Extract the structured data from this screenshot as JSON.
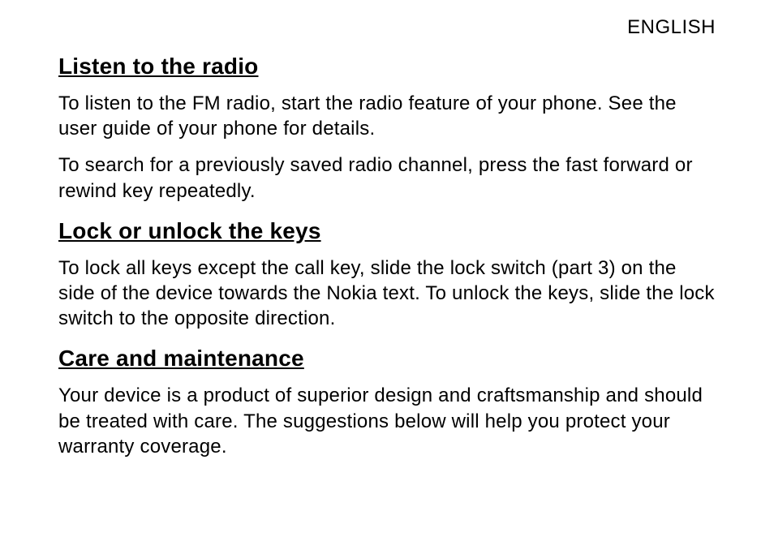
{
  "header": {
    "language": "ENGLISH"
  },
  "sections": [
    {
      "heading": "Listen to the radio",
      "paragraphs": [
        "To listen to the FM radio, start the radio feature of your phone. See the user guide of your phone for details.",
        "To search for a previously saved radio channel, press the fast forward or rewind key repeatedly."
      ]
    },
    {
      "heading": "Lock or unlock the keys",
      "paragraphs": [
        "To lock all keys except the call key, slide the lock switch (part 3) on the side of the device towards the Nokia text. To unlock the keys, slide the lock switch to the opposite direction."
      ]
    },
    {
      "heading": "Care and maintenance",
      "paragraphs": [
        "Your device is a product of superior design and craftsmanship and should be treated with care. The suggestions below will help you protect your warranty coverage."
      ]
    }
  ]
}
